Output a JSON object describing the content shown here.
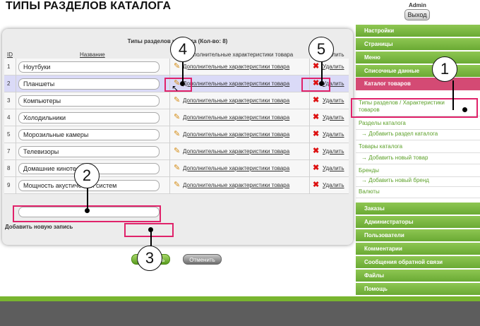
{
  "page_title": "ТИПЫ РАЗДЕЛОВ КАТАЛОГА",
  "admin": {
    "username": "Admin",
    "logout_label": "Выход"
  },
  "panel": {
    "header": "Типы разделов каталога (Кол-во: 8)",
    "columns": {
      "id": "ID",
      "name": "Название",
      "props": "Дополнительные характеристики товара",
      "delete": "Удалить"
    },
    "rows": [
      {
        "id": "1",
        "name": "Ноутбуки",
        "props_link": "Дополнительные характеристики товара",
        "delete_link": "Удалить"
      },
      {
        "id": "2",
        "name": "Планшеты",
        "props_link": "Дополнительные характеристики товара",
        "delete_link": "Удалить",
        "selected": true
      },
      {
        "id": "3",
        "name": "Компьютеры",
        "props_link": "Дополнительные характеристики товара",
        "delete_link": "Удалить"
      },
      {
        "id": "4",
        "name": "Холодильники",
        "props_link": "Дополнительные характеристики товара",
        "delete_link": "Удалить"
      },
      {
        "id": "5",
        "name": "Морозильные камеры",
        "props_link": "Дополнительные характеристики товара",
        "delete_link": "Удалить"
      },
      {
        "id": "7",
        "name": "Телевизоры",
        "props_link": "Дополнительные характеристики товара",
        "delete_link": "Удалить"
      },
      {
        "id": "8",
        "name": "Домашние кинотеатры",
        "props_link": "Дополнительные характеристики товара",
        "delete_link": "Удалить"
      },
      {
        "id": "9",
        "name": "Мощность акустических систем",
        "props_link": "Дополнительные характеристики товара",
        "delete_link": "Удалить"
      }
    ],
    "add_label": "Добавить новую запись",
    "new_value": "",
    "save_label": "Сохранить",
    "cancel_label": "Отменить"
  },
  "sidebar": {
    "top_items": [
      "Настройки",
      "Страницы",
      "Меню",
      "Списочные данные"
    ],
    "active_item": "Каталог товаров",
    "sub_items": [
      {
        "label": "Типы разделов / Характеристики товаров",
        "indent": false
      },
      {
        "label": "Разделы каталога",
        "indent": false
      },
      {
        "label": "→ Добавить раздел каталога",
        "indent": true
      },
      {
        "label": "Товары каталога",
        "indent": false
      },
      {
        "label": "→ Добавить новый товар",
        "indent": true
      },
      {
        "label": "Бренды",
        "indent": false
      },
      {
        "label": "→ Добавить новый бренд",
        "indent": true
      },
      {
        "label": "Валюты",
        "indent": false
      }
    ],
    "bottom_items": [
      "Заказы",
      "Администраторы",
      "Пользователи",
      "Комментарии",
      "Сообщения обратной связи",
      "Файлы",
      "Помощь"
    ]
  },
  "callouts": [
    "1",
    "2",
    "3",
    "4",
    "5"
  ],
  "icons": {
    "edit": "pencil-icon",
    "delete": "delete-x-icon"
  },
  "colors": {
    "accent_green": "#79b52f",
    "highlight_pink": "#e0226a",
    "active_pink": "#d44a74"
  }
}
